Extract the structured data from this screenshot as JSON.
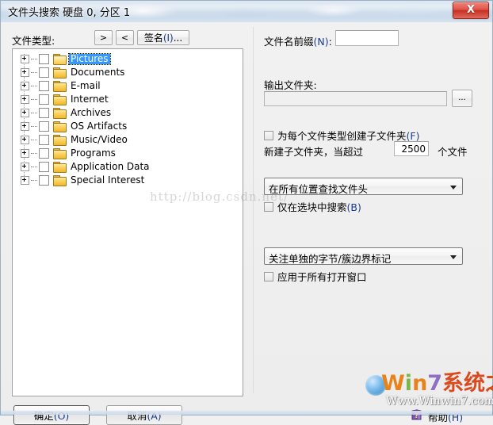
{
  "window": {
    "title": "文件头搜索 硬盘 0, 分区 1",
    "close_label": "X",
    "close_icon": "close-icon"
  },
  "left_panel": {
    "filetype_label": "文件类型:",
    "add_button": ">",
    "remove_button": "<",
    "signature_button": "签名(I)...",
    "tree_items": [
      {
        "label": "Pictures",
        "selected": true
      },
      {
        "label": "Documents",
        "selected": false
      },
      {
        "label": "E-mail",
        "selected": false
      },
      {
        "label": "Internet",
        "selected": false
      },
      {
        "label": "Archives",
        "selected": false
      },
      {
        "label": "OS Artifacts",
        "selected": false
      },
      {
        "label": "Music/Video",
        "selected": false
      },
      {
        "label": "Programs",
        "selected": false
      },
      {
        "label": "Application Data",
        "selected": false
      },
      {
        "label": "Special Interest",
        "selected": false
      }
    ]
  },
  "right_panel": {
    "prefix_label": "文件名前缀(N):",
    "prefix_value": "",
    "prefix_placeholder": "",
    "outfolder_label": "输出文件夹:",
    "outfolder_value": "",
    "outfolder_placeholder": "",
    "browse_button": "...",
    "subfolder_checkbox": "为每个文件类型创建子文件夹(F)",
    "count_label": "新建子文件夹，当超过",
    "count_value": "2500",
    "count_suffix": "个文件",
    "scope_combo": "在所有位置查找文件头",
    "block_checkbox": "仅在选块中搜索(B)",
    "align_combo": "关注单独的字节/簇边界标记",
    "applyall_checkbox": "应用于所有打开窗口"
  },
  "footer": {
    "ok_button": "确定(O)",
    "cancel_button": "取消(A)",
    "help_button": "帮助(H)",
    "help_icon": "help-book-icon"
  },
  "watermarks": {
    "blog_text": "http://blog.csdn.net/",
    "brand_w": "W",
    "brand_i": "i",
    "brand_n": "n",
    "brand_7": "7",
    "brand_cn": "系统之家",
    "brand_url": "Www.Winwin7.com"
  },
  "colors": {
    "selection": "#3399ff",
    "close_red": "#c72f22",
    "accent_blue": "#1a3c8c",
    "brand_orange": "#e8821a",
    "brand_green": "#7ab648",
    "brand_purple": "#8e6fc4",
    "brand_red": "#d94a1e"
  }
}
